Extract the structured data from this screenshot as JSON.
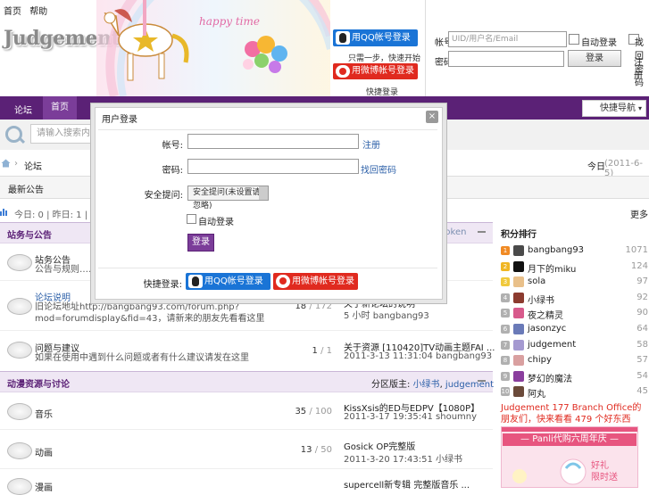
{
  "header": {
    "top_links": [
      "首页",
      "帮助"
    ],
    "logo_text": "Judgement",
    "banner_text": "happy time",
    "qq_login": "用QQ帐号登录",
    "weibo_hint": "只需一步，快速开始",
    "weibo_login": "用微博帐号登录",
    "quick_login": "快捷登录",
    "account_label": "帐号",
    "account_placeholder": "UID/用户名/Email",
    "password_label": "密码",
    "auto_login": "自动登录",
    "login_button": "登录",
    "find_password": "找回密码",
    "register": "注册"
  },
  "nav": {
    "items": [
      "论坛",
      "首页"
    ],
    "quick_nav": "快捷导航"
  },
  "search": {
    "placeholder": "请输入搜索内容"
  },
  "breadcrumb": {
    "current": "论坛"
  },
  "date": {
    "label": "今日",
    "value": "(2011-6-5)"
  },
  "notice": "最新公告",
  "stats": {
    "text": "今日: 0  |  昨日: 1  |  帖子: 2"
  },
  "right_more": "更多",
  "sections": [
    {
      "title": "站务与公告",
      "moderator": "Token",
      "forums": [
        {
          "name": "站务公告",
          "desc": "公告与规则……新手请看",
          "count": "",
          "last_title": "",
          "last_meta": ""
        },
        {
          "name": "论坛说明",
          "desc": "旧论坛地址http://bangbang93.com/forum.php?",
          "desc2": "mod=forumdisplay&fid=43，请新来的朋友先看看这里",
          "count": "18",
          "count_sub": "/ 172",
          "last_title": "关于新论坛的说明",
          "last_meta": "5 小时 bangbang93"
        },
        {
          "name": "问题与建议",
          "desc": "如果在使用中遇到什么问题或者有什么建议请发在这里",
          "count": "1",
          "count_sub": "/ 1",
          "last_title": "关于资源 [110420]TV动画主题FAI ...",
          "last_meta": "2011-3-13 11:31:04 bangbang93"
        }
      ]
    },
    {
      "title": "动漫资源与讨论",
      "moderator_label": "分区版主:",
      "moderators": [
        "小绿书",
        "judgement"
      ],
      "forums": [
        {
          "name": "音乐",
          "count": "35",
          "count_sub": "/ 100",
          "last_title": "KissXsis的ED与EDPV【1080P】",
          "last_meta": "2011-3-17 19:35:41 shoumny"
        },
        {
          "name": "动画",
          "count": "13",
          "count_sub": "/ 50",
          "last_title": "Gosick OP完整版",
          "last_meta": "2011-3-20 17:43:51 小绿书"
        },
        {
          "name": "漫画",
          "count": "",
          "count_sub": "",
          "last_title": "supercell新专辑 完整版音乐 ...",
          "last_meta": ""
        }
      ]
    }
  ],
  "ranking": {
    "title": "积分排行",
    "entries": [
      {
        "rank": "1",
        "name": "bangbang93",
        "score": "1071"
      },
      {
        "rank": "2",
        "name": "月下的miku",
        "score": "124"
      },
      {
        "rank": "3",
        "name": "sola",
        "score": "97"
      },
      {
        "rank": "4",
        "name": "小绿书",
        "score": "92"
      },
      {
        "rank": "5",
        "name": "夜之精灵",
        "score": "90"
      },
      {
        "rank": "6",
        "name": "jasonzyc",
        "score": "64"
      },
      {
        "rank": "7",
        "name": "judgement",
        "score": "58"
      },
      {
        "rank": "8",
        "name": "chipy",
        "score": "57"
      },
      {
        "rank": "9",
        "name": "梦幻的魔法",
        "score": "54"
      },
      {
        "rank": "10",
        "name": "阿丸",
        "score": "45"
      }
    ]
  },
  "promo": {
    "link": "Judgement 177 Branch Office的朋友们，快来看看 479 个好东西",
    "title": "— Panli代购六周年庆 —",
    "sub1": "好礼",
    "sub2": "限时送"
  },
  "modal": {
    "title": "用户登录",
    "close": "×",
    "username_label": "帐号:",
    "username_link": "注册",
    "password_label": "密码:",
    "password_link": "找回密码",
    "question_label": "安全提问:",
    "question_value": "安全提问(未设置请忽略)",
    "auto_login": "自动登录",
    "submit": "登录",
    "quick_label": "快捷登录:",
    "qq_login": "用QQ帐号登录",
    "weibo_login": "用微博帐号登录"
  },
  "colors": {
    "nav": "#5b2176",
    "accent": "#7b3d99",
    "qq": "#1a74d6",
    "weibo": "#e02a1f"
  }
}
